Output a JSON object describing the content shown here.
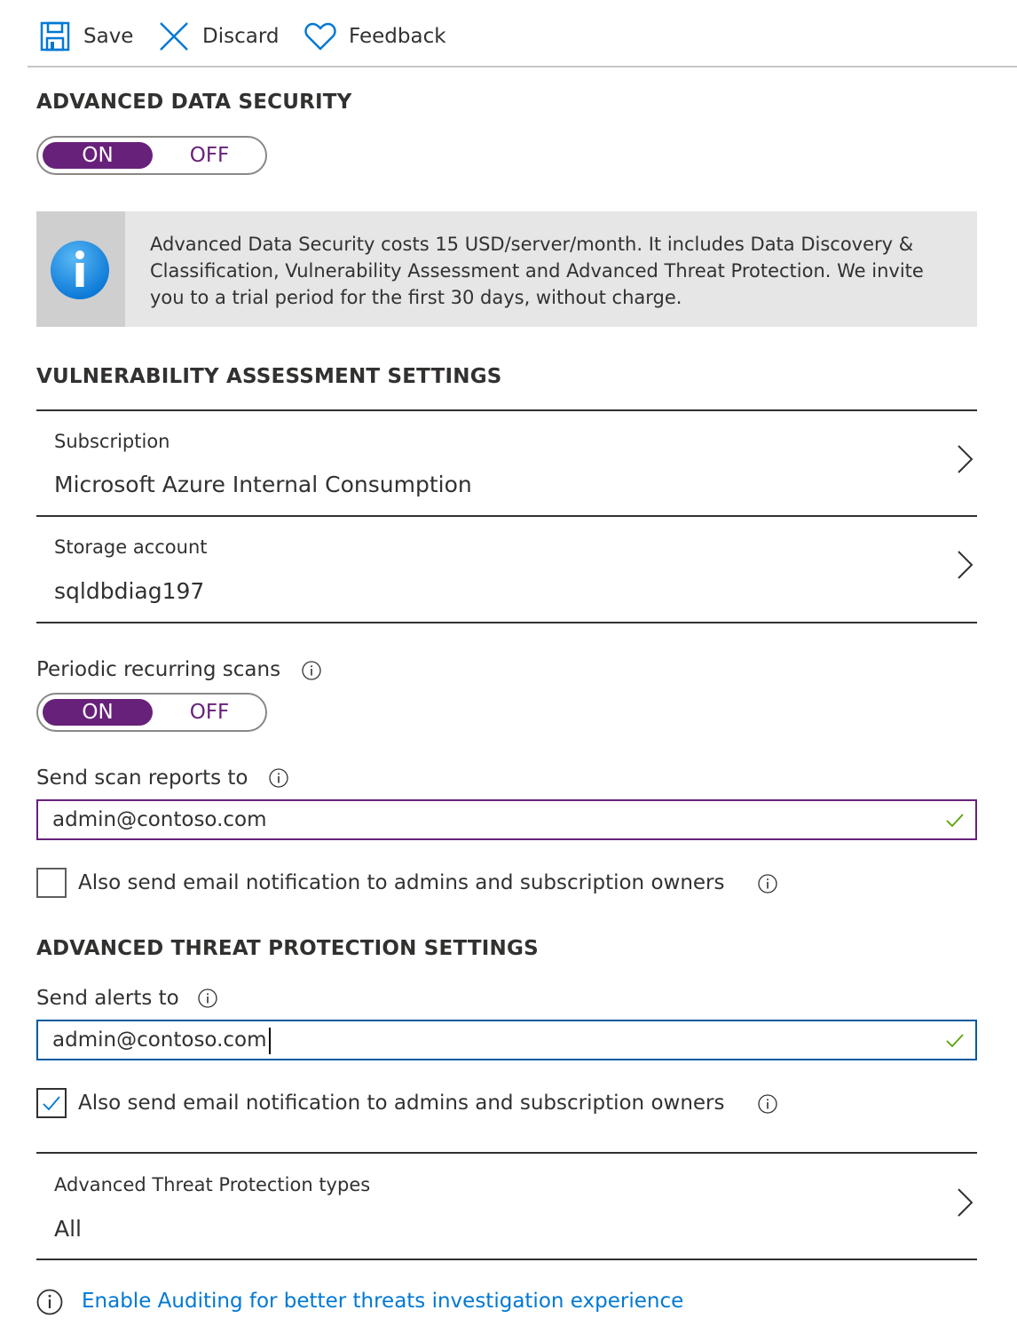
{
  "toolbar": {
    "save_label": "Save",
    "discard_label": "Discard",
    "feedback_label": "Feedback"
  },
  "advanced_data_security": {
    "title": "ADVANCED DATA SECURITY",
    "toggle_on": "ON",
    "toggle_off": "OFF",
    "selected": "ON",
    "info_text": "Advanced Data Security costs 15 USD/server/month. It includes Data Discovery & Classification, Vulnerability Assessment and Advanced Threat Protection. We invite you to a trial period for the first 30 days, without charge."
  },
  "vulnerability": {
    "title": "VULNERABILITY ASSESSMENT SETTINGS",
    "subscription_label": "Subscription",
    "subscription_value": "Microsoft Azure Internal Consumption",
    "storage_label": "Storage account",
    "storage_value": "sqldbdiag197",
    "periodic_label": "Periodic recurring scans",
    "periodic_on": "ON",
    "periodic_off": "OFF",
    "periodic_selected": "ON",
    "send_reports_label": "Send scan reports to",
    "send_reports_value": "admin@contoso.com",
    "notify_label": "Also send email notification to admins and subscription owners",
    "notify_checked": false
  },
  "threat_protection": {
    "title": "ADVANCED THREAT PROTECTION SETTINGS",
    "send_alerts_label": "Send alerts to",
    "send_alerts_value": "admin@contoso.com",
    "notify_label": "Also send email notification to admins and subscription owners",
    "notify_checked": true,
    "types_label": "Advanced Threat Protection types",
    "types_value": "All"
  },
  "footer": {
    "link_text": "Enable Auditing for better threats investigation experience"
  },
  "colors": {
    "accent_purple": "#68217a",
    "link_blue": "#0078d4",
    "focus_blue": "#005a9e",
    "valid_green": "#57a300"
  }
}
